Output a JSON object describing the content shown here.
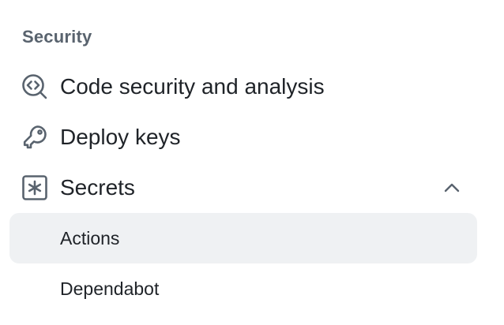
{
  "section": {
    "heading": "Security"
  },
  "items": [
    {
      "label": "Code security and analysis",
      "icon": "codescan-icon"
    },
    {
      "label": "Deploy keys",
      "icon": "key-icon"
    },
    {
      "label": "Secrets",
      "icon": "asterisk-box-icon",
      "expanded": true
    }
  ],
  "sub_items": [
    {
      "label": "Actions",
      "selected": true
    },
    {
      "label": "Dependabot",
      "selected": false
    }
  ],
  "colors": {
    "heading": "#59636e",
    "text": "#1f2328",
    "selected_bg": "#eff1f3"
  }
}
